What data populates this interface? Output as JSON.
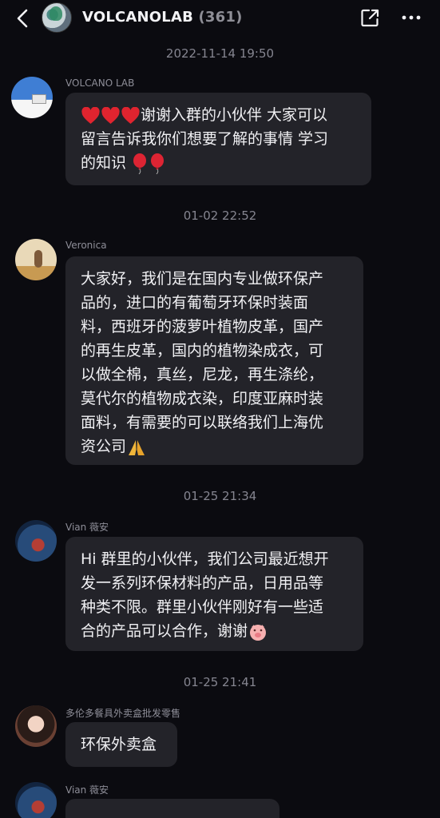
{
  "header": {
    "title": "VOLCANOLAB",
    "member_count": "(361)"
  },
  "icons": {
    "back": "chevron-left-icon",
    "share": "external-share-icon",
    "more": "more-dots-icon",
    "heart": "red-heart-emoji",
    "balloon": "balloon-emoji",
    "pray": "folded-hands-emoji",
    "blush": "blushing-pig-emoji"
  },
  "colors": {
    "background": "#0b0b10",
    "bubble": "#232329",
    "timestamp": "#858590",
    "sender": "#8e8e98",
    "heart": "#e0242f"
  },
  "timeline": [
    {
      "time": "2022-11-14 19:50",
      "sender": "VOLCANO LAB",
      "lines": [
        "谢谢入群的小伙伴 大家可以",
        "留言告诉我你们想要了解的事情 学习",
        "的知识"
      ]
    },
    {
      "time": "01-02 22:52",
      "sender": "Veronica",
      "lines": [
        "大家好，我们是在国内专业做环保产",
        "品的，进口的有葡萄牙环保时装面",
        "料，西班牙的菠萝叶植物皮革，国产",
        "的再生皮革，国内的植物染成衣，可",
        "以做全棉，真丝，尼龙，再生涤纶，",
        "莫代尔的植物成衣染，印度亚麻时装",
        "面料，有需要的可以联络我们上海优",
        "资公司"
      ]
    },
    {
      "time": "01-25 21:34",
      "sender": "Vian 薇安",
      "lines": [
        "Hi 群里的小伙伴，我们公司最近想开",
        "发一系列环保材料的产品，日用品等",
        "种类不限。群里小伙伴刚好有一些适",
        "合的产品可以合作，谢谢"
      ]
    },
    {
      "time": "01-25 21:41",
      "sender": "多伦多餐具外卖盒批发零售",
      "lines": [
        "环保外卖盒"
      ]
    },
    {
      "sender": "Vian 薇安"
    }
  ]
}
